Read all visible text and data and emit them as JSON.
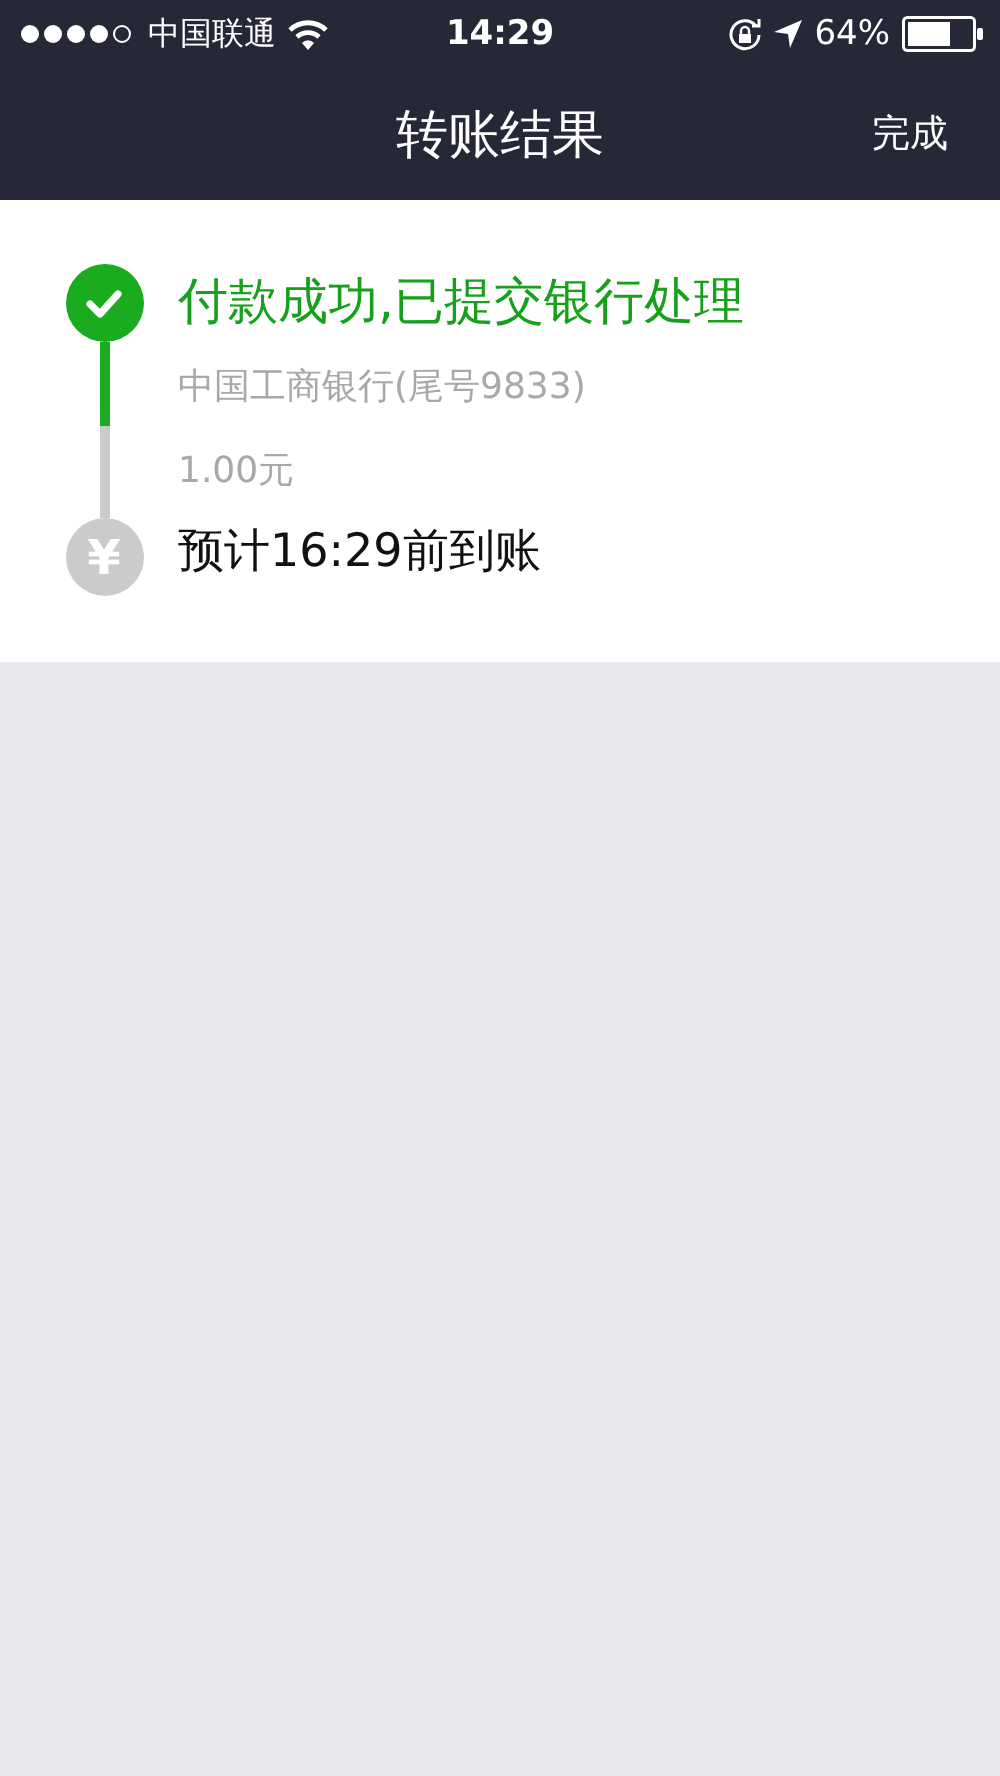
{
  "status_bar": {
    "carrier": "中国联通",
    "time": "14:29",
    "battery": "64%"
  },
  "nav_bar": {
    "title": "转账结果",
    "action": "完成"
  },
  "steps": [
    {
      "kind": "done",
      "title": "付款成功,已提交银行处理",
      "details": [
        "中国工商银行(尾号9833)",
        "1.00元"
      ]
    },
    {
      "kind": "pending",
      "icon": "¥",
      "title": "预计16:29前到账"
    }
  ]
}
